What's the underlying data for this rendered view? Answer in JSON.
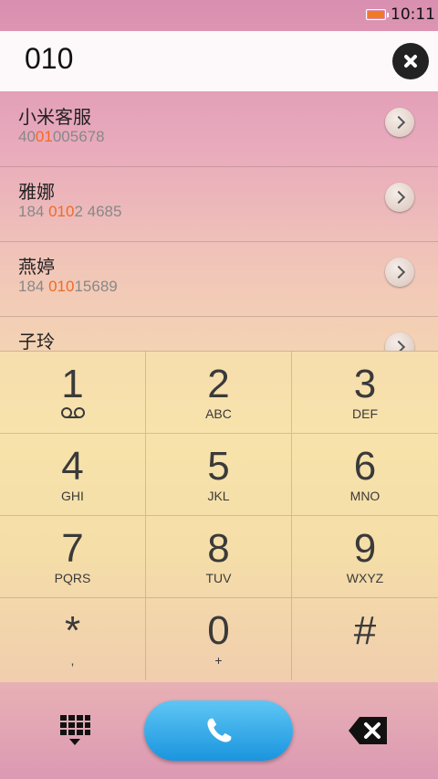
{
  "status_bar": {
    "time": "10:11",
    "battery_color": "#f07a2a"
  },
  "dial_input": {
    "value": "010"
  },
  "contacts": [
    {
      "name": "小米客服",
      "number_pre": "40",
      "number_match": "01",
      "number_post": "005678"
    },
    {
      "name": "雅娜",
      "number_pre": "184 ",
      "number_match": "010",
      "number_post": "2 4685"
    },
    {
      "name": "燕婷",
      "number_pre": "184 ",
      "number_match": "010",
      "number_post": "15689"
    },
    {
      "name": "子玲",
      "number_pre": "",
      "number_match": "",
      "number_post": ""
    }
  ],
  "keypad": [
    {
      "digit": "1",
      "letters": ""
    },
    {
      "digit": "2",
      "letters": "ABC"
    },
    {
      "digit": "3",
      "letters": "DEF"
    },
    {
      "digit": "4",
      "letters": "GHI"
    },
    {
      "digit": "5",
      "letters": "JKL"
    },
    {
      "digit": "6",
      "letters": "MNO"
    },
    {
      "digit": "7",
      "letters": "PQRS"
    },
    {
      "digit": "8",
      "letters": "TUV"
    },
    {
      "digit": "9",
      "letters": "WXYZ"
    },
    {
      "digit": "*",
      "letters": ","
    },
    {
      "digit": "0",
      "letters": "+"
    },
    {
      "digit": "#",
      "letters": ""
    }
  ],
  "colors": {
    "highlight": "#f06b23",
    "call_button": "#1a95de"
  },
  "icons": {
    "clear": "close-icon",
    "detail": "chevron-right-icon",
    "dialpad_toggle": "dialpad-icon",
    "call": "phone-icon",
    "backspace": "backspace-icon",
    "voicemail": "voicemail-icon"
  }
}
